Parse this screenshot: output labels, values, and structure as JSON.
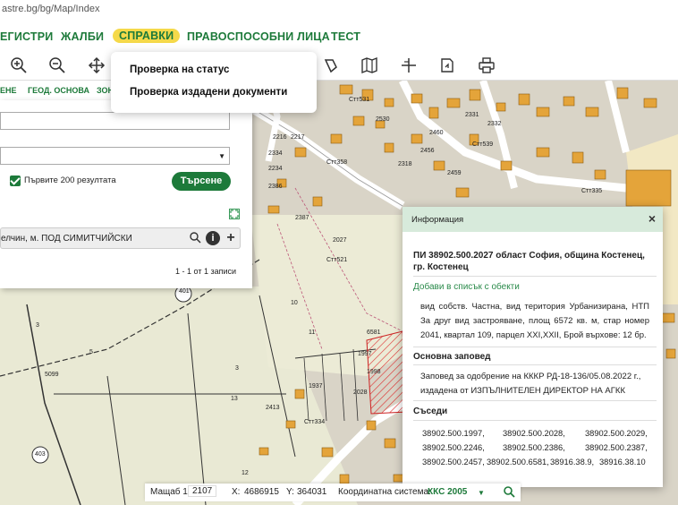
{
  "url": "astre.bg/bg/Map/Index",
  "nav": [
    {
      "label": "ЕГИСТРИ"
    },
    {
      "label": "ЖАЛБИ"
    },
    {
      "label": "СПРАВКИ"
    },
    {
      "label": "ПРАВОСПОСОБНИ ЛИЦА"
    },
    {
      "label": "ТЕСТ"
    }
  ],
  "dropdown": {
    "item1": "Проверка на статус",
    "item2": "Проверка издадени документи"
  },
  "subtabs": [
    "ЕНЕ",
    "ГЕОД. ОСНОВА",
    "ЗОН"
  ],
  "search": {
    "checkbox_label": "Първите 200 резултата",
    "search_button": "Търсене",
    "result_text": "елчин, м. ПОД СИМИТЧИЙСКИ",
    "pagination": "1 - 1 от 1 записи"
  },
  "info": {
    "header": "Информация",
    "title": "ПИ 38902.500.2027 област София, община Костенец, гр. Костенец",
    "add_link": "Добави в списък с обекти",
    "description": "вид собств. Частна, вид територия Урбанизирана, НТП За друг вид застрояване, площ 6572 кв. м, стар номер 2041, квартал 109, парцел XXI,XXII, Брой върхове: 12 бр.",
    "order_heading": "Основна заповед",
    "order_text": "Заповед за одобрение на КККР РД-18-136/05.08.2022 г., издадена от ИЗПЪЛНИТЕЛЕН ДИРЕКТОР НА АГКК",
    "neighbors_heading": "Съседи",
    "neighbors": [
      [
        "38902.500.1997,",
        "38902.500.2028,",
        "38902.500.2029,"
      ],
      [
        "38902.500.2246,",
        "38902.500.2386,",
        "38902.500.2387,"
      ],
      [
        "38902.500.2457,",
        "38902.500.6581,",
        "38916.38.9,",
        "38916.38.10"
      ]
    ]
  },
  "status": {
    "scale_label": "Мащаб 1:",
    "scale_value": "2107",
    "x_label": "X:",
    "x_value": "4686915",
    "y_label": "Y:",
    "y_value": "364031",
    "crs_label": "Координатна система:",
    "crs_value": "ККС 2005"
  },
  "map_labels": {
    "l2027": "2027",
    "l2387": "2387",
    "l2386": "2386",
    "l6581": "6581",
    "l1997": "1997",
    "l1937": "1937",
    "l13": "13",
    "l10": "10",
    "l11": "11",
    "l401": "401",
    "l403": "403",
    "l12": "12",
    "l3": "3",
    "l5": "5",
    "l2028": "2028",
    "l2413": "2413",
    "l5099": "5099",
    "l3n": "3",
    "street1": "Стт521",
    "street2": "Стт531",
    "street3": "Стт358",
    "street4": "Стт539",
    "street5": "Стт334",
    "street6": "Стт335",
    "l2334": "2334",
    "l2234": "2234",
    "l2216": "2216",
    "l2217": "2217",
    "l2530": "2530",
    "l2460": "2460",
    "l2456": "2456",
    "l2331": "2331",
    "l2318": "2318",
    "l2332": "2332",
    "l2459": "2459",
    "l1998": "1998"
  },
  "colors": {
    "accent": "#1d7a3a",
    "nav_active_bg": "#f5d94a",
    "building": "#e4a43a"
  }
}
